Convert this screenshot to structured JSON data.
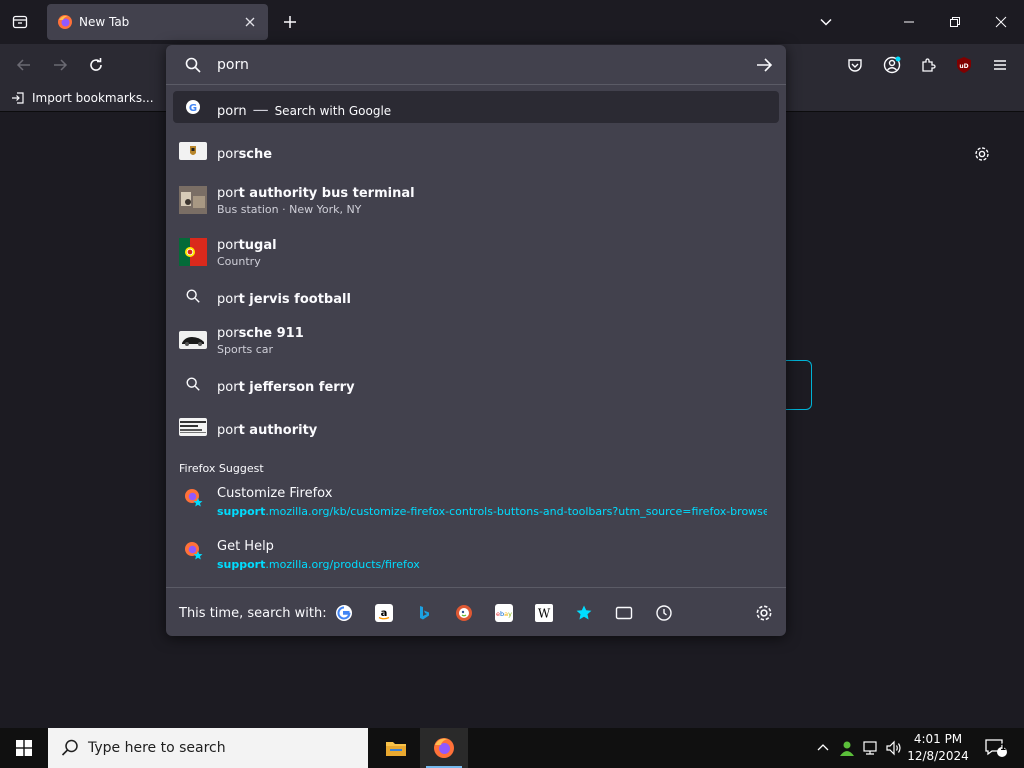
{
  "browser": {
    "tab": {
      "title": "New Tab"
    },
    "bookmarks": {
      "import_label": "Import bookmarks..."
    }
  },
  "urlbar": {
    "value": "porn",
    "heuristic": {
      "query": "porn",
      "action": "Search with Google"
    },
    "results": [
      {
        "typed": "por",
        "completion": "sche",
        "sub": "",
        "icon": "porsche-logo"
      },
      {
        "typed": "por",
        "completion": "t authority bus terminal",
        "sub": "Bus station · New York, NY",
        "icon": "bus-terminal-photo"
      },
      {
        "typed": "por",
        "completion": "tugal",
        "sub": "Country",
        "icon": "portugal-flag"
      },
      {
        "typed": "por",
        "completion": "t jervis football",
        "sub": "",
        "icon": "search-icon"
      },
      {
        "typed": "por",
        "completion": "sche 911",
        "sub": "Sports car",
        "icon": "porsche-911-photo"
      },
      {
        "typed": "por",
        "completion": "t jefferson ferry",
        "sub": "",
        "icon": "search-icon"
      },
      {
        "typed": "por",
        "completion": "t authority",
        "sub": "",
        "icon": "port-authority-logo"
      }
    ],
    "suggest_group": "Firefox Suggest",
    "suggest": [
      {
        "title": "Customize Firefox",
        "url_hl": "support",
        "url_rest": ".mozilla.org/kb/customize-firefox-controls-buttons-and-toolbars?utm_source=firefox-browser&"
      },
      {
        "title": "Get Help",
        "url_hl": "support",
        "url_rest": ".mozilla.org/products/firefox"
      }
    ],
    "oneoff_label": "This time, search with:",
    "engines": [
      "google",
      "amazon",
      "bing",
      "duckduckgo",
      "ebay",
      "wikipedia",
      "bookmarks",
      "tabs",
      "history"
    ]
  },
  "taskbar": {
    "search_placeholder": "Type here to search",
    "time": "4:01 PM",
    "date": "12/8/2024",
    "notification_count": "1"
  },
  "colors": {
    "accent": "#00ddff",
    "panel": "#42414d",
    "toolbar": "#2b2a33",
    "bg": "#1c1b22"
  }
}
